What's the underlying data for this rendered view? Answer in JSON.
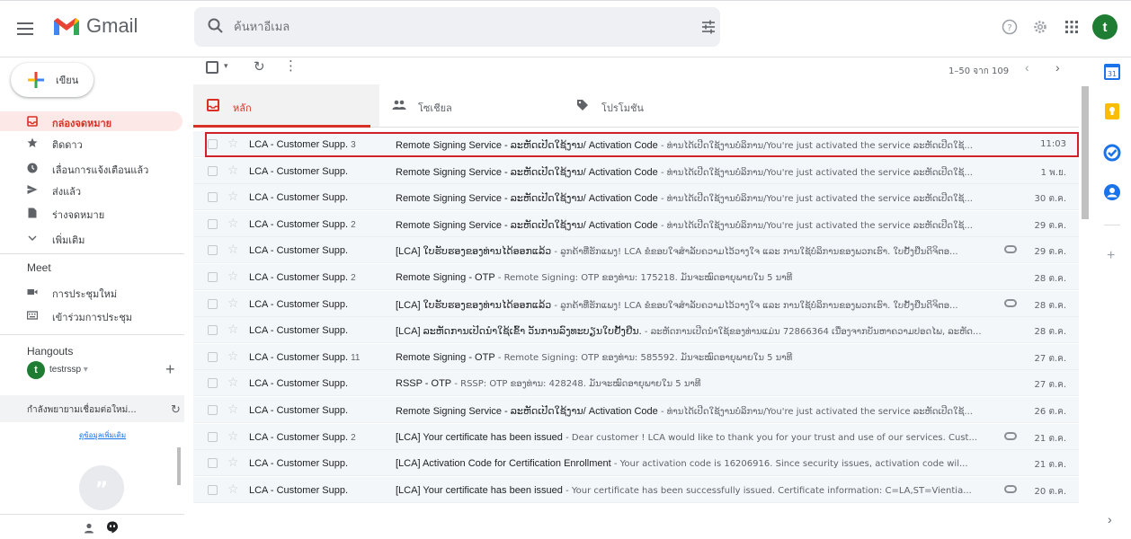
{
  "header": {
    "app_name": "Gmail",
    "search_placeholder": "ค้นหาอีเมล"
  },
  "nav": {
    "compose_label": "เขียน",
    "items": [
      {
        "label": "กล่องจดหมาย",
        "icon": "inbox-icon",
        "active": true
      },
      {
        "label": "ติดดาว",
        "icon": "star-icon"
      },
      {
        "label": "เลื่อนการแจ้งเตือนแล้ว",
        "icon": "clock-icon"
      },
      {
        "label": "ส่งแล้ว",
        "icon": "send-icon"
      },
      {
        "label": "ร่างจดหมาย",
        "icon": "draft-icon"
      },
      {
        "label": "เพิ่มเติม",
        "icon": "chevron-down-icon"
      }
    ]
  },
  "meet": {
    "title": "Meet",
    "items": [
      {
        "label": "การประชุมใหม่",
        "icon": "video-icon"
      },
      {
        "label": "เข้าร่วมการประชุม",
        "icon": "keyboard-icon"
      }
    ]
  },
  "hangouts": {
    "title": "Hangouts",
    "avatar_letter": "t",
    "user": "testrssp",
    "status": "กำลังพยายามเชื่อมต่อใหม่...",
    "more_info": "ดูข้อมูลเพิ่มเติม"
  },
  "toolbar": {
    "page_info": "1–50 จาก 109"
  },
  "tabs": [
    {
      "label": "หลัก",
      "icon": "inbox-icon",
      "active": true
    },
    {
      "label": "โซเชียล",
      "icon": "people-icon"
    },
    {
      "label": "โปรโมชัน",
      "icon": "tag-icon"
    }
  ],
  "emails": [
    {
      "sender": "LCA - Customer Supp.",
      "count": "3",
      "subject": "Remote Signing Service - ລະຫັດເປີດໃຊ້ງານ/ Activation Code",
      "snippet": "ທ່ານໄດ້ເປີດໃຊ້ງານບໍລິການ/You're just activated the service ລະຫັດເປີດໃຊ້...",
      "date": "11:03",
      "attachment": false
    },
    {
      "sender": "LCA - Customer Supp.",
      "count": "",
      "subject": "Remote Signing Service - ລະຫັດເປີດໃຊ້ງານ/ Activation Code",
      "snippet": "ທ່ານໄດ້ເປີດໃຊ້ງານບໍລິການ/You're just activated the service ລະຫັດເປີດໃຊ້...",
      "date": "1 พ.ย.",
      "attachment": false
    },
    {
      "sender": "LCA - Customer Supp.",
      "count": "",
      "subject": "Remote Signing Service - ລະຫັດເປີດໃຊ້ງານ/ Activation Code",
      "snippet": "ທ່ານໄດ້ເປີດໃຊ້ງານບໍລິການ/You're just activated the service ລະຫັດເປີດໃຊ້...",
      "date": "30 ต.ค.",
      "attachment": false
    },
    {
      "sender": "LCA - Customer Supp.",
      "count": "2",
      "subject": "Remote Signing Service - ລະຫັດເປີດໃຊ້ງານ/ Activation Code",
      "snippet": "ທ່ານໄດ້ເປີດໃຊ້ງານບໍລິການ/You're just activated the service ລະຫັດເປີດໃຊ້...",
      "date": "29 ต.ค.",
      "attachment": false
    },
    {
      "sender": "LCA - Customer Supp.",
      "count": "",
      "subject": "[LCA] ໃບຮັບຮອງຂອງທ່ານໄດ້ອອກແລ້ວ",
      "snippet": "ລູກຄ້າທີ່ຮັກແພງ! LCA ຂໍຂອບໃຈສໍາລັບຄວາມໄວ້ວາງໃຈ ແລະ ການໃຊ້ບໍລິການຂອງພວກເຮົາ. ໃບຢັ້ງຢືນດິຈິຕອ...",
      "date": "29 ต.ค.",
      "attachment": true
    },
    {
      "sender": "LCA - Customer Supp.",
      "count": "2",
      "subject": "Remote Signing - OTP",
      "snippet": "Remote Signing: OTP ຂອງທ່ານ: 175218. ມັນຈະໝົດອາຍຸພາຍໃນ 5 ນາທີ",
      "date": "28 ต.ค.",
      "attachment": false
    },
    {
      "sender": "LCA - Customer Supp.",
      "count": "",
      "subject": "[LCA] ໃບຮັບຮອງຂອງທ່ານໄດ້ອອກແລ້ວ",
      "snippet": "ລູກຄ້າທີ່ຮັກແພງ! LCA ຂໍຂອບໃຈສໍາລັບຄວາມໄວ້ວາງໃຈ ແລະ ການໃຊ້ບໍລິການຂອງພວກເຮົາ. ໃບຢັ້ງຢືນດິຈິຕອ...",
      "date": "28 ต.ค.",
      "attachment": true
    },
    {
      "sender": "LCA - Customer Supp.",
      "count": "",
      "subject": "[LCA] ລະຫັດການເປີດນຳໃຊ້ເຂົ້າ ວັນການລົງທະບຽນໃບຢັ້ງຢືນ.",
      "snippet": "ລະຫັດການເປີດນຳໃຊ້ຂອງທ່ານແມ່ນ 72866364 ເນື່ອງຈາກບັນຫາຄວາມປອດໄພ, ລະຫັດ...",
      "date": "28 ต.ค.",
      "attachment": false
    },
    {
      "sender": "LCA - Customer Supp.",
      "count": "11",
      "subject": "Remote Signing - OTP",
      "snippet": "Remote Signing: OTP ຂອງທ່ານ: 585592. ມັນຈະໝົດອາຍຸພາຍໃນ 5 ນາທີ",
      "date": "27 ต.ค.",
      "attachment": false
    },
    {
      "sender": "LCA - Customer Supp.",
      "count": "",
      "subject": "RSSP - OTP",
      "snippet": "RSSP: OTP ຂອງທ່ານ: 428248. ມັນຈະໝົດອາຍຸພາຍໃນ 5 ນາທີ",
      "date": "27 ต.ค.",
      "attachment": false
    },
    {
      "sender": "LCA - Customer Supp.",
      "count": "",
      "subject": "Remote Signing Service - ລະຫັດເປີດໃຊ້ງານ/ Activation Code",
      "snippet": "ທ່ານໄດ້ເປີດໃຊ້ງານບໍລິການ/You're just activated the service ລະຫັດເປີດໃຊ້...",
      "date": "26 ต.ค.",
      "attachment": false
    },
    {
      "sender": "LCA - Customer Supp.",
      "count": "2",
      "subject": "[LCA] Your certificate has been issued",
      "snippet": "Dear customer ! LCA would like to thank you for your trust and use of our services. Cust...",
      "date": "21 ต.ค.",
      "attachment": true
    },
    {
      "sender": "LCA - Customer Supp.",
      "count": "",
      "subject": "[LCA] Activation Code for Certification Enrollment",
      "snippet": "Your activation code is 16206916. Since security issues, activation code wil...",
      "date": "21 ต.ค.",
      "attachment": false
    },
    {
      "sender": "LCA - Customer Supp.",
      "count": "",
      "subject": "[LCA] Your certificate has been issued",
      "snippet": "Your certificate has been successfully issued. Certificate information: C=LA,ST=Vientia...",
      "date": "20 ต.ค.",
      "attachment": true
    }
  ],
  "colors": {
    "accent": "#d93025",
    "row_background": "#f4f7fa",
    "highlight_border": "#d0202a"
  }
}
